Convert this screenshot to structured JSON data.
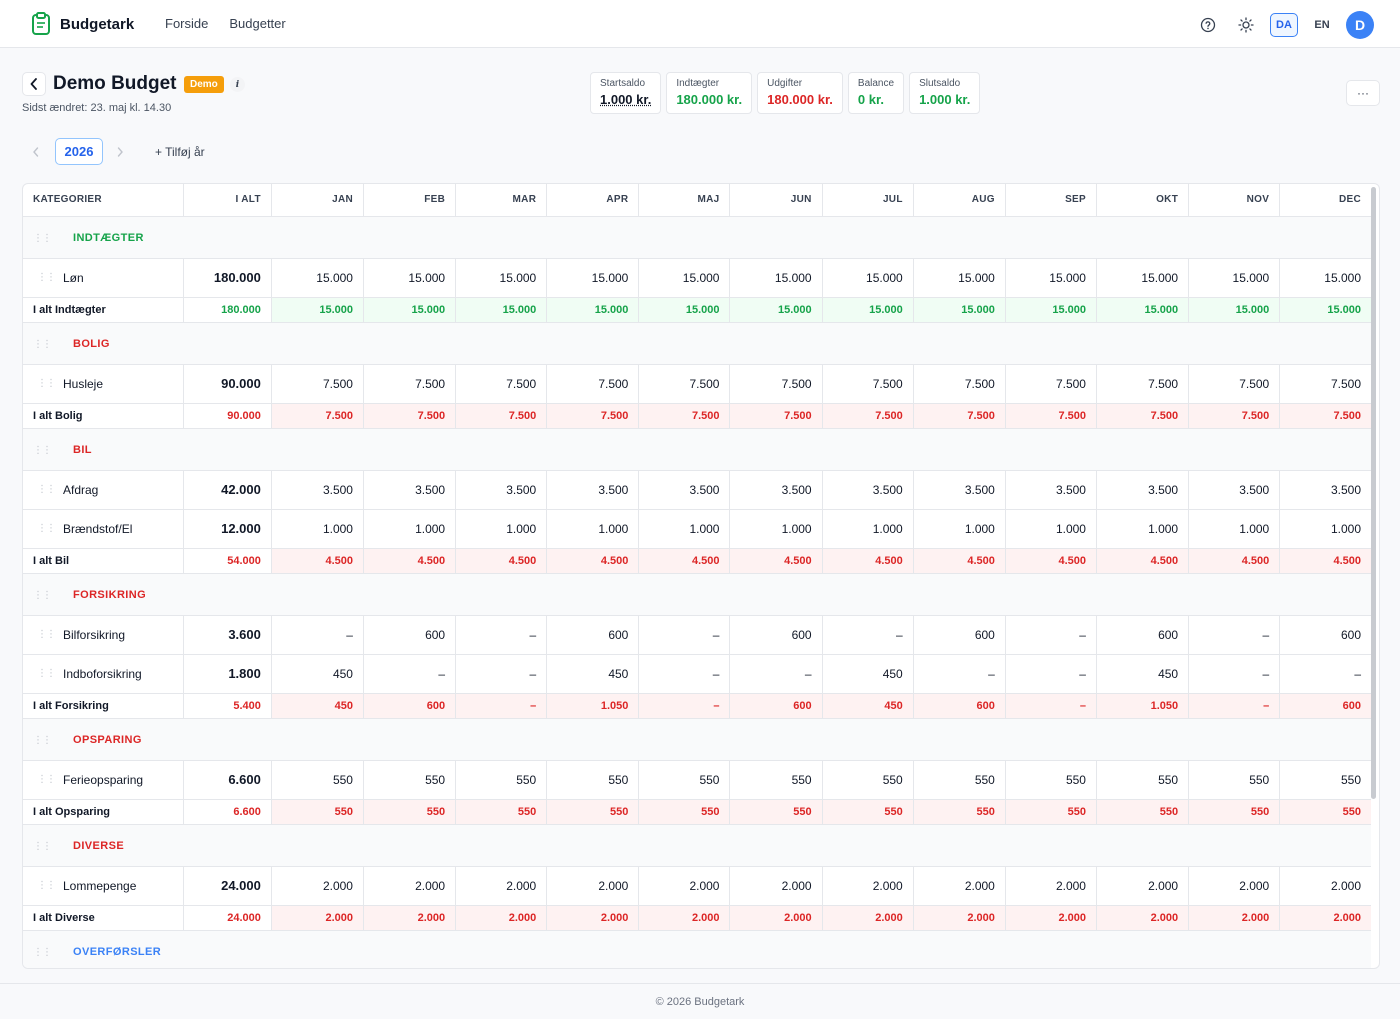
{
  "app": {
    "name": "Budgetark"
  },
  "nav": [
    {
      "label": "Forside"
    },
    {
      "label": "Budgetter"
    }
  ],
  "header": {
    "lang_da": "DA",
    "lang_en": "EN",
    "avatar_initial": "D"
  },
  "budget": {
    "title": "Demo Budget",
    "badge": "Demo",
    "info": "i",
    "last_changed": "Sidst ændret: 23. maj kl. 14.30"
  },
  "stats": [
    {
      "label": "Startsaldo",
      "value": "1.000 kr.",
      "color": "#111827"
    },
    {
      "label": "Indtægter",
      "value": "180.000 kr.",
      "color": "#16a34a"
    },
    {
      "label": "Udgifter",
      "value": "180.000 kr.",
      "color": "#dc2626"
    },
    {
      "label": "Balance",
      "value": "0 kr.",
      "color": "#16a34a"
    },
    {
      "label": "Slutsaldo",
      "value": "1.000 kr.",
      "color": "#16a34a"
    }
  ],
  "menu_label": "···",
  "year": {
    "current": "2026",
    "add_label": "+ Tilføj år"
  },
  "table": {
    "headers": [
      "KATEGORIER",
      "I ALT",
      "JAN",
      "FEB",
      "MAR",
      "APR",
      "MAJ",
      "JUN",
      "JUL",
      "AUG",
      "SEP",
      "OKT",
      "NOV",
      "DEC"
    ],
    "categories": [
      {
        "name": "INDTÆGTER",
        "type": "income",
        "color": "#16a34a",
        "items": [
          {
            "name": "Løn",
            "total": "180.000",
            "months": [
              "15.000",
              "15.000",
              "15.000",
              "15.000",
              "15.000",
              "15.000",
              "15.000",
              "15.000",
              "15.000",
              "15.000",
              "15.000",
              "15.000"
            ]
          }
        ],
        "sum": {
          "label": "I alt Indtægter",
          "total": "180.000",
          "months": [
            "15.000",
            "15.000",
            "15.000",
            "15.000",
            "15.000",
            "15.000",
            "15.000",
            "15.000",
            "15.000",
            "15.000",
            "15.000",
            "15.000"
          ]
        }
      },
      {
        "name": "BOLIG",
        "type": "expense",
        "color": "#dc2626",
        "items": [
          {
            "name": "Husleje",
            "total": "90.000",
            "months": [
              "7.500",
              "7.500",
              "7.500",
              "7.500",
              "7.500",
              "7.500",
              "7.500",
              "7.500",
              "7.500",
              "7.500",
              "7.500",
              "7.500"
            ]
          }
        ],
        "sum": {
          "label": "I alt Bolig",
          "total": "90.000",
          "months": [
            "7.500",
            "7.500",
            "7.500",
            "7.500",
            "7.500",
            "7.500",
            "7.500",
            "7.500",
            "7.500",
            "7.500",
            "7.500",
            "7.500"
          ]
        }
      },
      {
        "name": "BIL",
        "type": "expense",
        "color": "#dc2626",
        "items": [
          {
            "name": "Afdrag",
            "total": "42.000",
            "months": [
              "3.500",
              "3.500",
              "3.500",
              "3.500",
              "3.500",
              "3.500",
              "3.500",
              "3.500",
              "3.500",
              "3.500",
              "3.500",
              "3.500"
            ]
          },
          {
            "name": "Brændstof/El",
            "total": "12.000",
            "months": [
              "1.000",
              "1.000",
              "1.000",
              "1.000",
              "1.000",
              "1.000",
              "1.000",
              "1.000",
              "1.000",
              "1.000",
              "1.000",
              "1.000"
            ]
          }
        ],
        "sum": {
          "label": "I alt Bil",
          "total": "54.000",
          "months": [
            "4.500",
            "4.500",
            "4.500",
            "4.500",
            "4.500",
            "4.500",
            "4.500",
            "4.500",
            "4.500",
            "4.500",
            "4.500",
            "4.500"
          ]
        }
      },
      {
        "name": "FORSIKRING",
        "type": "expense",
        "color": "#dc2626",
        "items": [
          {
            "name": "Bilforsikring",
            "total": "3.600",
            "months": [
              "–",
              "600",
              "–",
              "600",
              "–",
              "600",
              "–",
              "600",
              "–",
              "600",
              "–",
              "600"
            ]
          },
          {
            "name": "Indboforsikring",
            "total": "1.800",
            "months": [
              "450",
              "–",
              "–",
              "450",
              "–",
              "–",
              "450",
              "–",
              "–",
              "450",
              "–",
              "–"
            ]
          }
        ],
        "sum": {
          "label": "I alt Forsikring",
          "total": "5.400",
          "months": [
            "450",
            "600",
            "–",
            "1.050",
            "–",
            "600",
            "450",
            "600",
            "–",
            "1.050",
            "–",
            "600"
          ]
        }
      },
      {
        "name": "OPSPARING",
        "type": "expense",
        "color": "#dc2626",
        "items": [
          {
            "name": "Ferieopsparing",
            "total": "6.600",
            "months": [
              "550",
              "550",
              "550",
              "550",
              "550",
              "550",
              "550",
              "550",
              "550",
              "550",
              "550",
              "550"
            ]
          }
        ],
        "sum": {
          "label": "I alt Opsparing",
          "total": "6.600",
          "months": [
            "550",
            "550",
            "550",
            "550",
            "550",
            "550",
            "550",
            "550",
            "550",
            "550",
            "550",
            "550"
          ]
        }
      },
      {
        "name": "DIVERSE",
        "type": "expense",
        "color": "#dc2626",
        "items": [
          {
            "name": "Lommepenge",
            "total": "24.000",
            "months": [
              "2.000",
              "2.000",
              "2.000",
              "2.000",
              "2.000",
              "2.000",
              "2.000",
              "2.000",
              "2.000",
              "2.000",
              "2.000",
              "2.000"
            ]
          }
        ],
        "sum": {
          "label": "I alt Diverse",
          "total": "24.000",
          "months": [
            "2.000",
            "2.000",
            "2.000",
            "2.000",
            "2.000",
            "2.000",
            "2.000",
            "2.000",
            "2.000",
            "2.000",
            "2.000",
            "2.000"
          ]
        }
      },
      {
        "name": "OVERFØRSLER",
        "type": "transfer",
        "color": "#3b82f6",
        "items": [],
        "sum": null
      }
    ]
  },
  "footer": {
    "text": "© 2026 Budgetark"
  }
}
